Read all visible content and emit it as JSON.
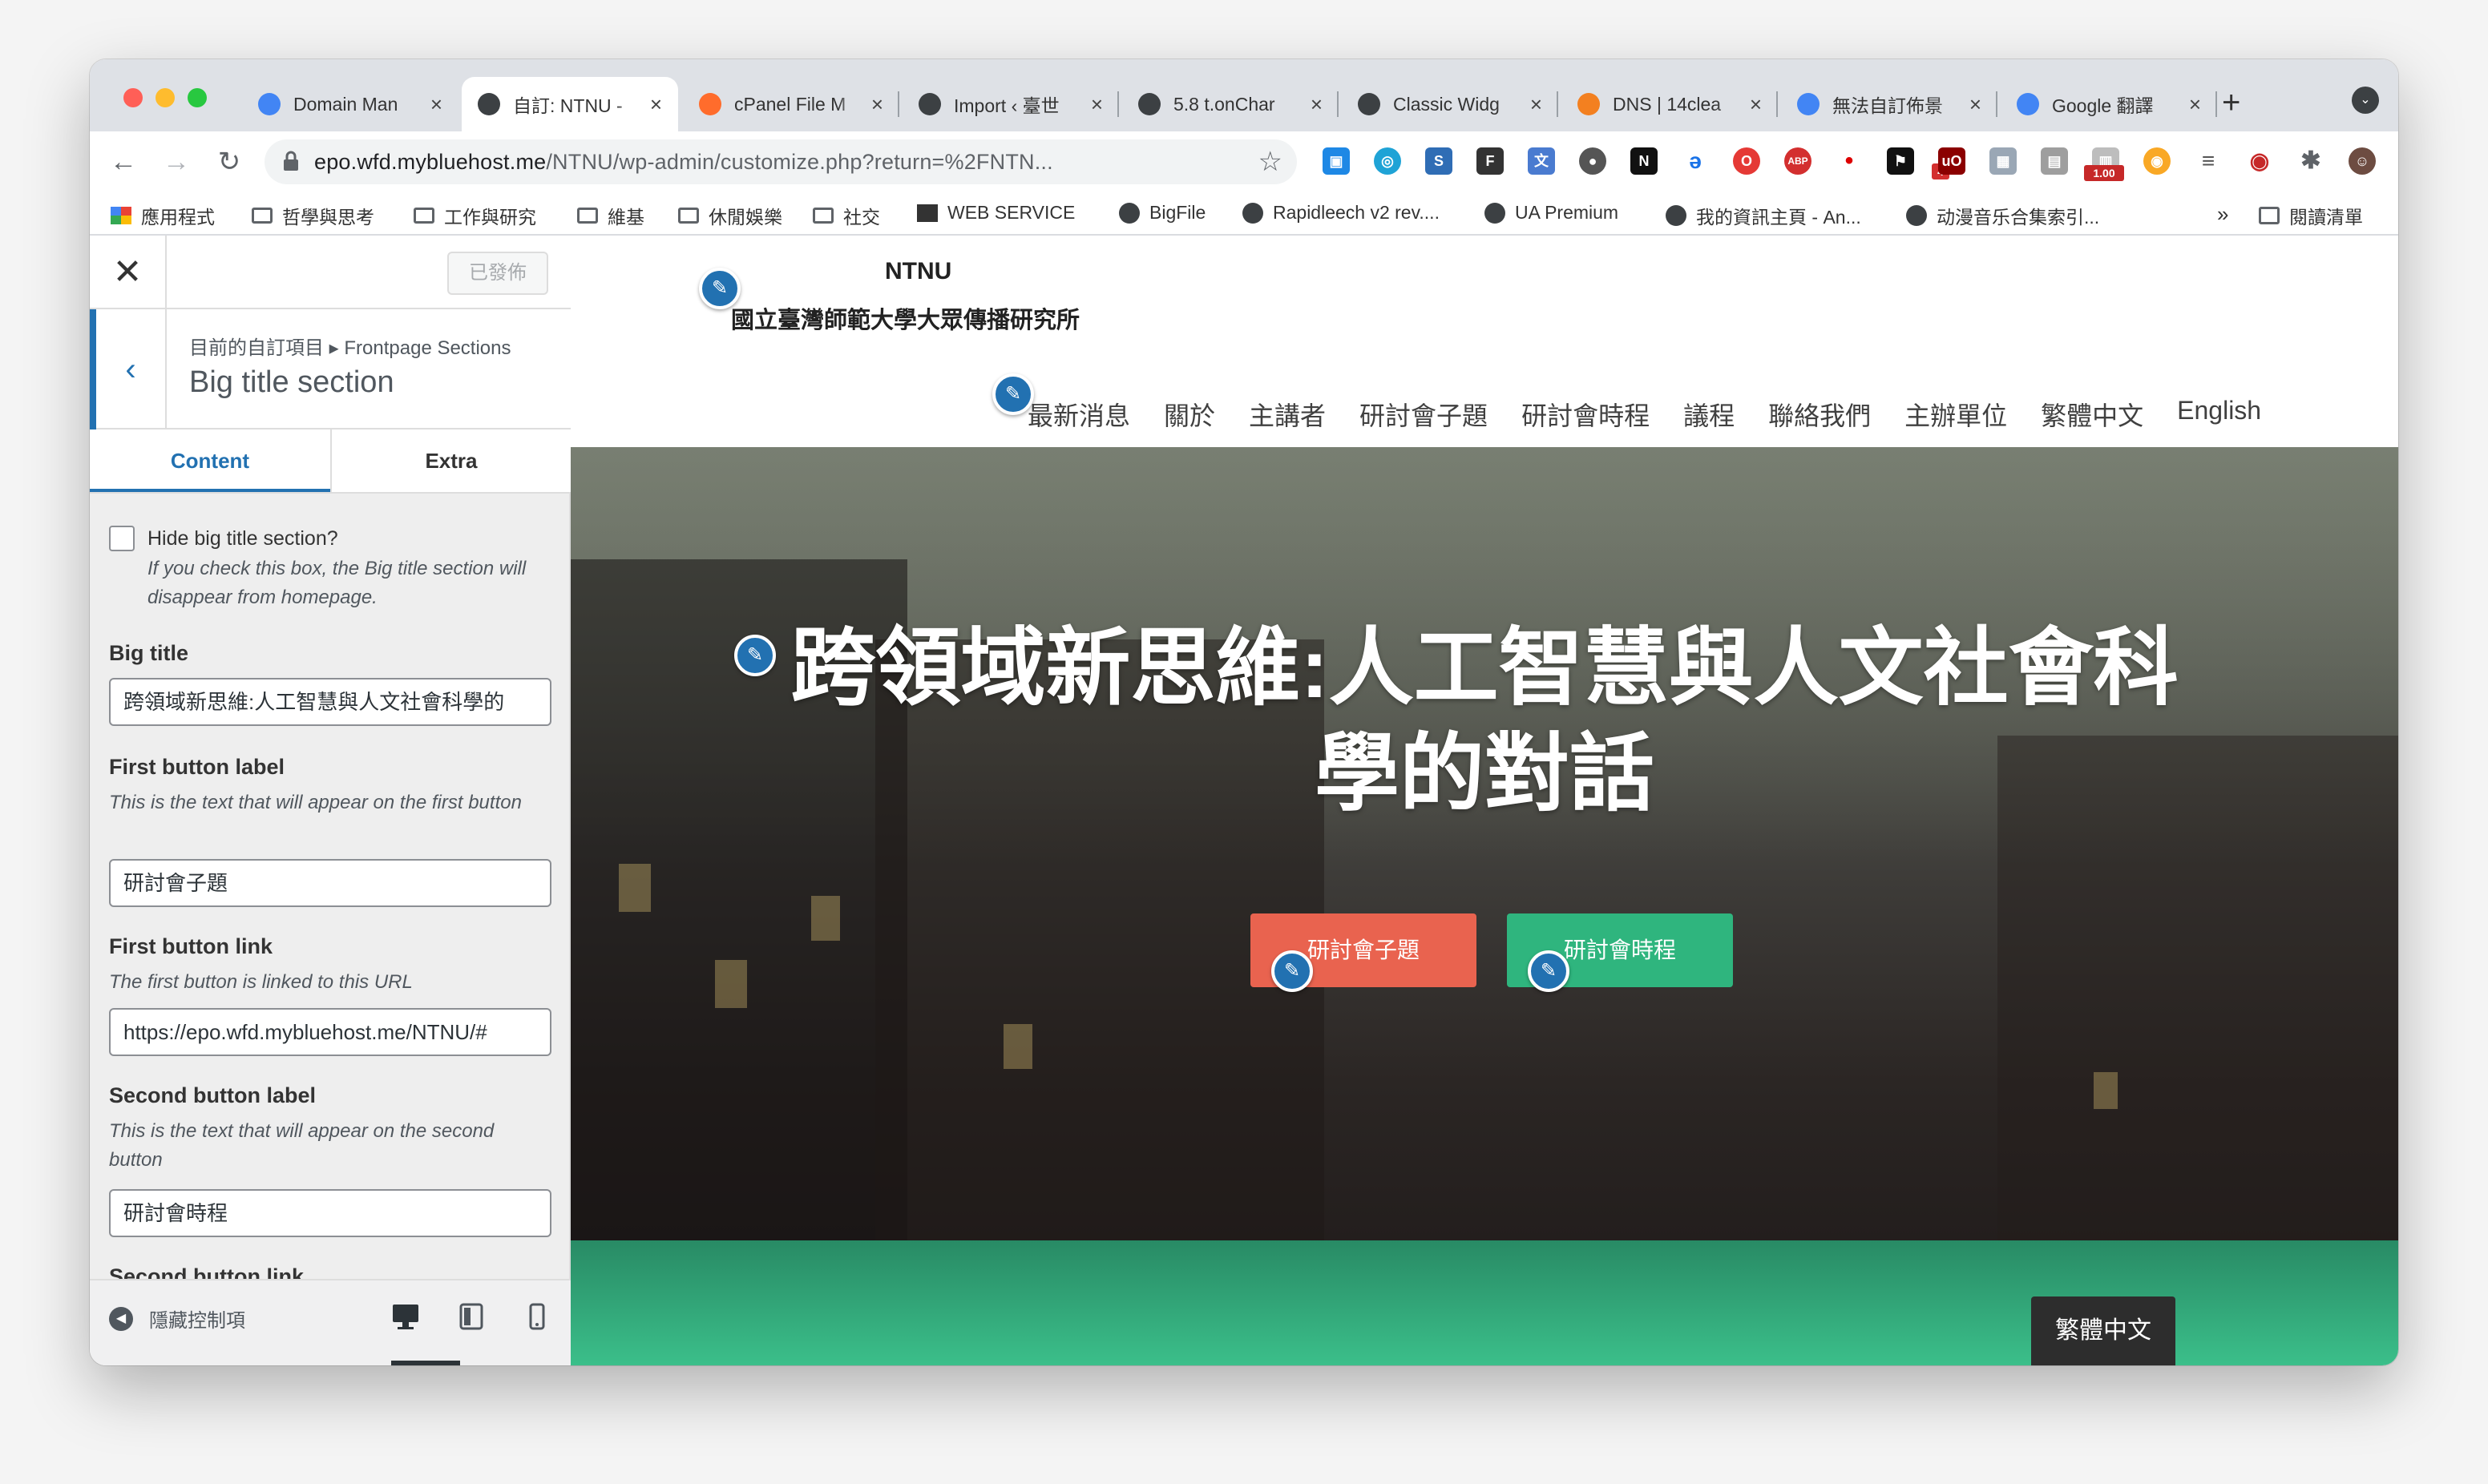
{
  "browser": {
    "tabs": [
      {
        "title": "Domain Man",
        "icon": "grid-icon",
        "color": "#4285f4"
      },
      {
        "title": "自訂: NTNU -",
        "icon": "wordpress-icon",
        "color": "#3c4043",
        "active": true
      },
      {
        "title": "cPanel File M",
        "icon": "cpanel-icon",
        "color": "#ff6c2c"
      },
      {
        "title": "Import ‹ 臺世",
        "icon": "wordpress-icon",
        "color": "#3c4043"
      },
      {
        "title": "5.8 t.onChar",
        "icon": "wordpress-icon",
        "color": "#3c4043"
      },
      {
        "title": "Classic Widg",
        "icon": "wordpress-icon",
        "color": "#3c4043"
      },
      {
        "title": "DNS | 14clea",
        "icon": "cloudflare-icon",
        "color": "#f38020"
      },
      {
        "title": "無法自訂佈景",
        "icon": "google-icon",
        "color": "#4285f4"
      },
      {
        "title": "Google 翻譯",
        "icon": "translate-icon",
        "color": "#4285f4"
      }
    ],
    "url_host": "epo.wfd.mybluehost.me",
    "url_path": "/NTNU/wp-admin/customize.php?return=%2FNTN...",
    "extension_badges": {
      "ublock": "4",
      "speed": "1.00"
    },
    "bookmarks": [
      {
        "label": "應用程式",
        "type": "apps"
      },
      {
        "label": "哲學與思考",
        "type": "folder"
      },
      {
        "label": "工作與研究",
        "type": "folder"
      },
      {
        "label": "維基",
        "type": "folder"
      },
      {
        "label": "休閒娛樂",
        "type": "folder"
      },
      {
        "label": "社交",
        "type": "folder"
      },
      {
        "label": "WEB SERVICE",
        "type": "film"
      },
      {
        "label": "BigFile",
        "type": "globe"
      },
      {
        "label": "Rapidleech v2 rev....",
        "type": "globe"
      },
      {
        "label": "UA Premium",
        "type": "globe"
      },
      {
        "label": "我的資訊主頁 - An...",
        "type": "globe"
      },
      {
        "label": "动漫音乐合集索引...",
        "type": "globe"
      }
    ],
    "bookmarks_more": "»",
    "reading_list": "閱讀清單"
  },
  "customizer": {
    "publish_label": "已發佈",
    "breadcrumb": "目前的自訂項目 ▸ Frontpage Sections",
    "section_title": "Big title section",
    "tabs": [
      "Content",
      "Extra"
    ],
    "hide_label": "Hide big title section?",
    "hide_desc": "If you check this box, the Big title section will disappear from homepage.",
    "big_title_label": "Big title",
    "big_title_value": "跨領域新思維:人工智慧與人文社會科學的",
    "first_btn_label": "First button label",
    "first_btn_desc": "This is the text that will appear on the first button",
    "first_btn_value": "研討會子題",
    "first_link_label": "First button link",
    "first_link_desc": "The first button is linked to this URL",
    "first_link_value": "https://epo.wfd.mybluehost.me/NTNU/#",
    "second_btn_label": "Second button label",
    "second_btn_desc": "This is the text that will appear on the second button",
    "second_btn_value": "研討會時程",
    "second_link_label": "Second button link",
    "hide_controls": "隱藏控制項"
  },
  "site": {
    "logo_line1": "NTNU",
    "logo_line2": "國立臺灣師範大學大眾傳播研究所",
    "menu": [
      "最新消息",
      "關於",
      "主講者",
      "研討會子題",
      "研討會時程",
      "議程",
      "聯絡我們",
      "主辦單位",
      "繁體中文",
      "English"
    ],
    "hero_title_line1": "跨領域新思維:人工智慧與人文社會科",
    "hero_title_line2": "學的對話",
    "button1": "研討會子題",
    "button2": "研討會時程",
    "button1_color": "#e9634f",
    "button2_color": "#2fb57e",
    "lang_switcher": "繁體中文"
  }
}
